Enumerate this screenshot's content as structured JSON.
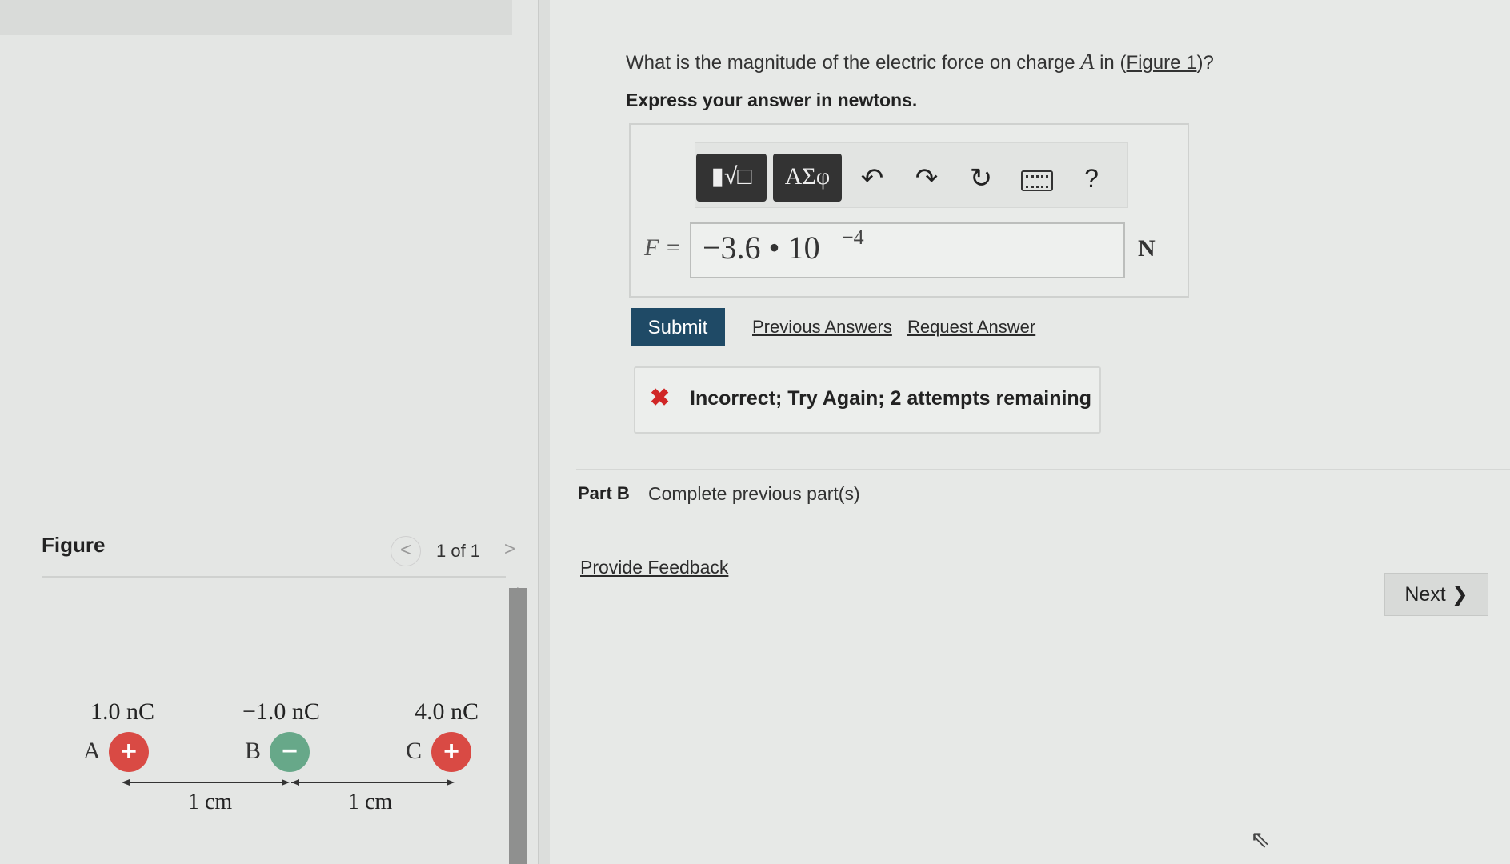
{
  "question": {
    "prefix": "What is the magnitude of the electric force on charge",
    "charge_symbol": "A",
    "mid": "in (",
    "figure_link": "Figure 1",
    "suffix": ")?",
    "instruction": "Express your answer in newtons."
  },
  "toolbar": {
    "templates_label": "▮√□",
    "symbols_label": "ΑΣφ",
    "undo_icon": "undo-icon",
    "redo_icon": "redo-icon",
    "reset_icon": "reset-icon",
    "keyboard_icon": "keyboard-icon",
    "help_label": "?"
  },
  "answer": {
    "variable": "F =",
    "value": "−3.6 • 10",
    "exponent": "−4",
    "unit": "N"
  },
  "actions": {
    "submit": "Submit",
    "previous_answers": "Previous Answers",
    "request_answer": "Request Answer"
  },
  "feedback": {
    "icon": "x-icon",
    "text": "Incorrect; Try Again; 2 attempts remaining",
    "color": "#d02626"
  },
  "part_b": {
    "label": "Part B",
    "text": "Complete previous part(s)"
  },
  "provide_feedback": "Provide Feedback",
  "next": "Next ❯",
  "figure": {
    "title": "Figure",
    "count": "1 of 1",
    "prev": "<",
    "next": ">",
    "charges": [
      {
        "name": "A",
        "value": "1.0 nC",
        "sign": "+",
        "color": "#d94a44"
      },
      {
        "name": "B",
        "value": "−1.0 nC",
        "sign": "−",
        "color": "#67a889"
      },
      {
        "name": "C",
        "value": "4.0 nC",
        "sign": "+",
        "color": "#d94a44"
      }
    ],
    "distances": [
      "1 cm",
      "1 cm"
    ]
  },
  "colors": {
    "submit_bg": "#1f4a66",
    "positive": "#d94a44",
    "negative": "#67a889"
  }
}
